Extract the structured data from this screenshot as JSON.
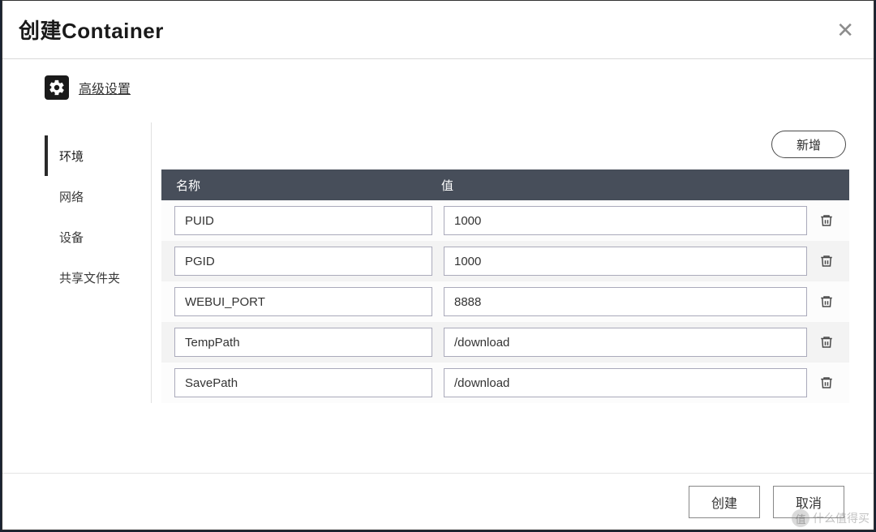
{
  "title": "创建Container",
  "advanced_link": "高级设置",
  "sidebar": {
    "items": [
      {
        "label": "环境",
        "active": true
      },
      {
        "label": "网络",
        "active": false
      },
      {
        "label": "设备",
        "active": false
      },
      {
        "label": "共享文件夹",
        "active": false
      }
    ]
  },
  "toolbar": {
    "add_label": "新增"
  },
  "table": {
    "head_name": "名称",
    "head_value": "值",
    "rows": [
      {
        "name": "PUID",
        "value": "1000"
      },
      {
        "name": "PGID",
        "value": "1000"
      },
      {
        "name": "WEBUI_PORT",
        "value": "8888"
      },
      {
        "name": "TempPath",
        "value": "/download"
      },
      {
        "name": "SavePath",
        "value": "/download"
      }
    ]
  },
  "footer": {
    "create": "创建",
    "cancel": "取消"
  },
  "watermark": "什么值得买"
}
